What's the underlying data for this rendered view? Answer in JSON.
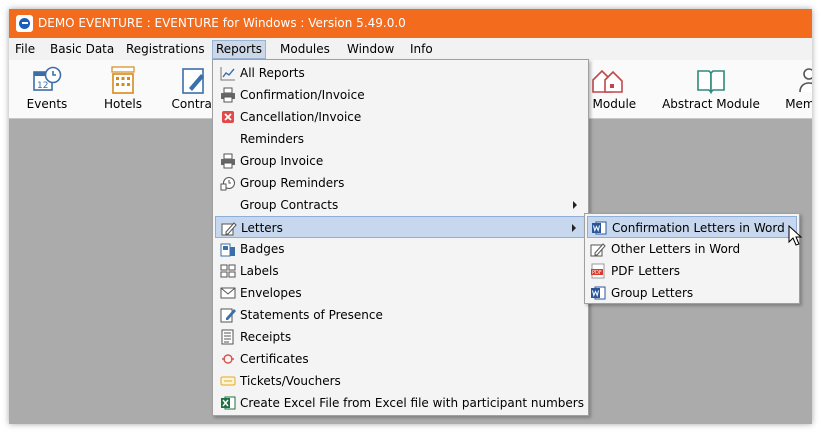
{
  "window": {
    "title": "DEMO EVENTURE : EVENTURE for Windows : Version 5.49.0.0"
  },
  "menubar": [
    {
      "label": "File"
    },
    {
      "label": "Basic Data"
    },
    {
      "label": "Registrations"
    },
    {
      "label": "Reports"
    },
    {
      "label": "Modules"
    },
    {
      "label": "Window"
    },
    {
      "label": "Info"
    }
  ],
  "toolbar": [
    {
      "label": "Events",
      "icon": "calendar-clock-icon"
    },
    {
      "label": "Hotels",
      "icon": "hotel-icon"
    },
    {
      "label": "Contrac",
      "icon": "contract-pen-icon"
    },
    {
      "label": "in Module",
      "icon": "houses-icon"
    },
    {
      "label": "Abstract Module",
      "icon": "book-icon"
    },
    {
      "label": "Members",
      "icon": "members-icon"
    }
  ],
  "reports_menu": [
    {
      "label": "All Reports",
      "icon": "chart-icon"
    },
    {
      "label": "Confirmation/Invoice",
      "icon": "printer-icon"
    },
    {
      "label": "Cancellation/Invoice",
      "icon": "cancel-icon"
    },
    {
      "label": "Reminders",
      "icon": ""
    },
    {
      "label": "Group Invoice",
      "icon": "printer-icon"
    },
    {
      "label": "Group Reminders",
      "icon": "group-reminder-icon"
    },
    {
      "label": "Group Contracts",
      "icon": ""
    },
    {
      "label": "Letters",
      "icon": "letter-pen-icon"
    },
    {
      "label": "Badges",
      "icon": "badge-icon"
    },
    {
      "label": "Labels",
      "icon": "labels-icon"
    },
    {
      "label": "Envelopes",
      "icon": "envelope-icon"
    },
    {
      "label": "Statements of Presence",
      "icon": "statement-icon"
    },
    {
      "label": "Receipts",
      "icon": "receipt-icon"
    },
    {
      "label": "Certificates",
      "icon": "certificate-icon"
    },
    {
      "label": "Tickets/Vouchers",
      "icon": "ticket-icon"
    },
    {
      "label": "Create Excel File from Excel file with participant numbers",
      "icon": "excel-icon"
    }
  ],
  "letters_submenu": [
    {
      "label": "Confirmation Letters in Word",
      "icon": "word-icon"
    },
    {
      "label": "Other Letters in Word",
      "icon": "letter-pen-icon"
    },
    {
      "label": "PDF Letters",
      "icon": "pdf-icon"
    },
    {
      "label": "Group Letters",
      "icon": "word-icon"
    }
  ],
  "colors": {
    "titlebar": "#f36b1c",
    "selection": "#c6d7ee",
    "workspace": "#ababab"
  }
}
